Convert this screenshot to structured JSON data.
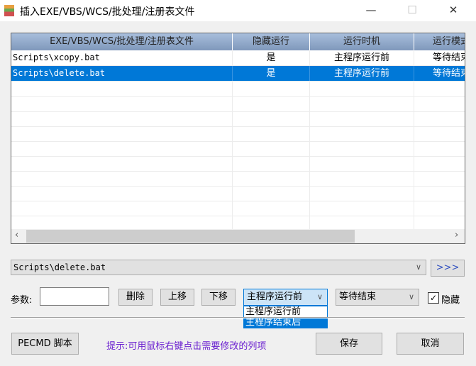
{
  "window": {
    "title": "插入EXE/VBS/WCS/批处理/注册表文件",
    "minimize": "—",
    "maximize": "☐",
    "close": "✕"
  },
  "table": {
    "columns": [
      "EXE/VBS/WCS/批处理/注册表文件",
      "隐藏运行",
      "运行时机",
      "运行模式"
    ],
    "rows": [
      {
        "file": "Scripts\\xcopy.bat",
        "hidden": "是",
        "timing": "主程序运行前",
        "mode": "等待结束"
      },
      {
        "file": "Scripts\\delete.bat",
        "hidden": "是",
        "timing": "主程序运行前",
        "mode": "等待结束"
      }
    ],
    "selected_row": 1
  },
  "file_combo": {
    "value": "Scripts\\delete.bat"
  },
  "browse_button": ">>>",
  "params": {
    "label": "参数:",
    "value": ""
  },
  "buttons": {
    "delete": "删除",
    "up": "上移",
    "down": "下移",
    "pecmd": "PECMD 脚本",
    "save": "保存",
    "cancel": "取消"
  },
  "timing_combo": {
    "value": "主程序运行前",
    "options": [
      "主程序运行前",
      "主程序结束后"
    ],
    "highlighted": 1
  },
  "mode_combo": {
    "value": "等待结束"
  },
  "hidden_checkbox": {
    "label": "隐藏",
    "checked": true
  },
  "hint": "提示:可用鼠标右键点击需要修改的列项"
}
